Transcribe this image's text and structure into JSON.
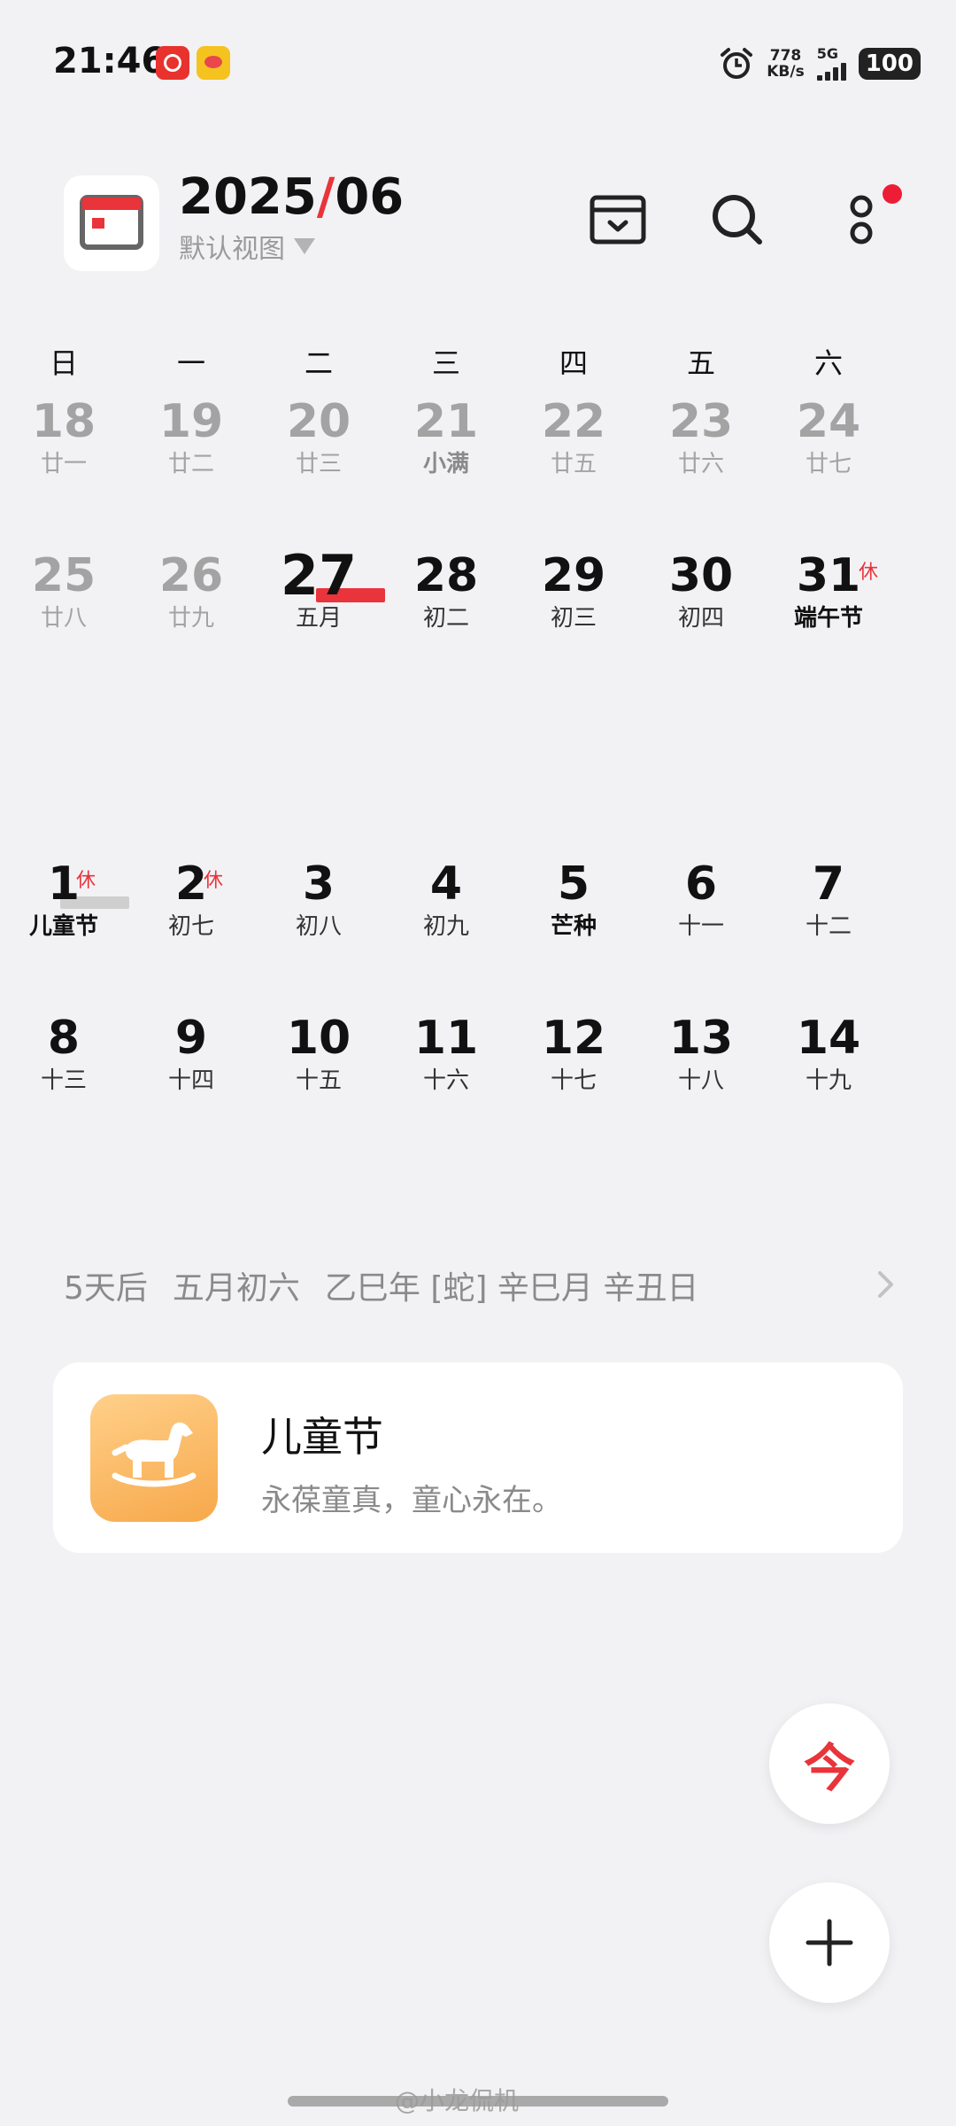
{
  "status_bar": {
    "time": "21:46",
    "net_speed_value": "778",
    "net_speed_unit": "KB/s",
    "network": "5G",
    "battery": "100",
    "icons": [
      "netease-music-icon",
      "weibo-icon",
      "alarm-icon",
      "signal-icon",
      "battery-icon"
    ]
  },
  "header": {
    "year": "2025",
    "slash": "/",
    "month": "06",
    "view_label": "默认视图",
    "buttons": [
      "inbox-icon",
      "search-icon",
      "more-icon"
    ],
    "accent_color": "#e8343a"
  },
  "weekdays": [
    "日",
    "一",
    "二",
    "三",
    "四",
    "五",
    "六"
  ],
  "weeks": [
    [
      {
        "num": "18",
        "sub": "廿一",
        "style": "dim"
      },
      {
        "num": "19",
        "sub": "廿二",
        "style": "dim"
      },
      {
        "num": "20",
        "sub": "廿三",
        "style": "dim"
      },
      {
        "num": "21",
        "sub": "小满",
        "style": "dim-bold"
      },
      {
        "num": "22",
        "sub": "廿五",
        "style": "dim"
      },
      {
        "num": "23",
        "sub": "廿六",
        "style": "dim"
      },
      {
        "num": "24",
        "sub": "廿七",
        "style": "dim"
      }
    ],
    [
      {
        "num": "25",
        "sub": "廿八",
        "style": "dim"
      },
      {
        "num": "26",
        "sub": "廿九",
        "style": "dim"
      },
      {
        "num": "27",
        "sub": "五月",
        "style": "today"
      },
      {
        "num": "28",
        "sub": "初二",
        "style": "cur"
      },
      {
        "num": "29",
        "sub": "初三",
        "style": "cur"
      },
      {
        "num": "30",
        "sub": "初四",
        "style": "cur"
      },
      {
        "num": "31",
        "sub": "端午节",
        "style": "cur-bold",
        "mark": "休"
      }
    ],
    [
      {
        "num": "1",
        "sub": "儿童节",
        "style": "selected",
        "mark": "休"
      },
      {
        "num": "2",
        "sub": "初七",
        "style": "cur",
        "mark": "休"
      },
      {
        "num": "3",
        "sub": "初八",
        "style": "cur"
      },
      {
        "num": "4",
        "sub": "初九",
        "style": "cur"
      },
      {
        "num": "5",
        "sub": "芒种",
        "style": "cur-bold"
      },
      {
        "num": "6",
        "sub": "十一",
        "style": "cur"
      },
      {
        "num": "7",
        "sub": "十二",
        "style": "cur"
      }
    ],
    [
      {
        "num": "8",
        "sub": "十三",
        "style": "cur"
      },
      {
        "num": "9",
        "sub": "十四",
        "style": "cur"
      },
      {
        "num": "10",
        "sub": "十五",
        "style": "cur"
      },
      {
        "num": "11",
        "sub": "十六",
        "style": "cur"
      },
      {
        "num": "12",
        "sub": "十七",
        "style": "cur"
      },
      {
        "num": "13",
        "sub": "十八",
        "style": "cur"
      },
      {
        "num": "14",
        "sub": "十九",
        "style": "cur"
      }
    ]
  ],
  "info": {
    "days_from_today": "5天后",
    "lunar_date": "五月初六",
    "ganzhi": "乙巳年 [蛇] 辛巳月 辛丑日"
  },
  "event": {
    "title": "儿童节",
    "subtitle": "永葆童真，童心永在。",
    "icon": "rocking-horse-icon"
  },
  "fab": {
    "today_label": "今",
    "add_icon": "plus-icon"
  },
  "watermark": "@小龙侃机"
}
